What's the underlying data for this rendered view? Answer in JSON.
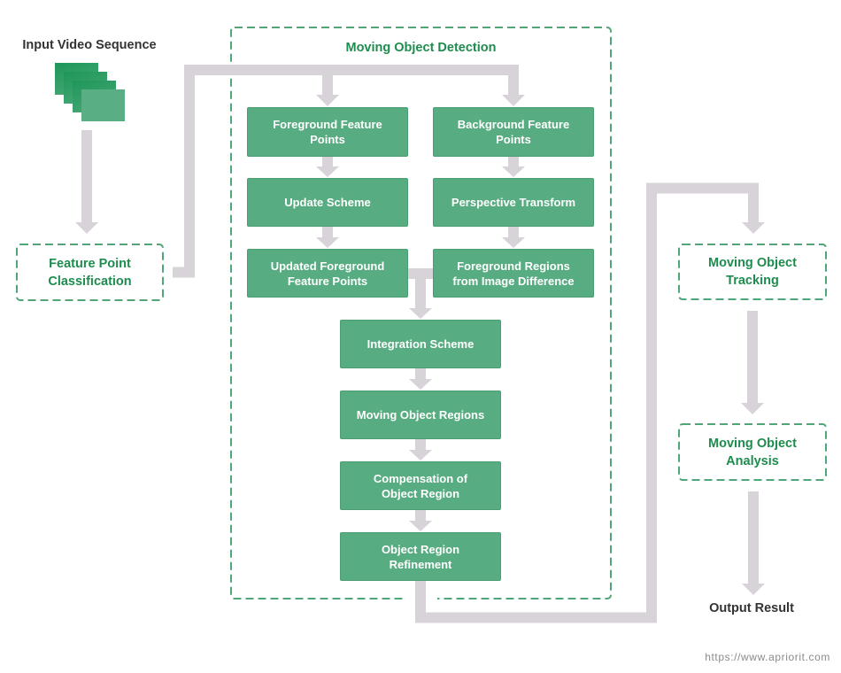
{
  "input": {
    "label": "Input Video Sequence",
    "frame_count": 4
  },
  "classification": {
    "lines": [
      "Feature Point",
      "Classification"
    ]
  },
  "detection": {
    "title": "Moving Object Detection",
    "left_column": [
      {
        "lines": [
          "Foreground Feature",
          "Points"
        ]
      },
      {
        "lines": [
          "Update Scheme"
        ]
      },
      {
        "lines": [
          "Updated Foreground",
          "Feature Points"
        ]
      }
    ],
    "right_column": [
      {
        "lines": [
          "Background Feature",
          "Points"
        ]
      },
      {
        "lines": [
          "Perspective Transform"
        ]
      },
      {
        "lines": [
          "Foreground Regions",
          "from Image Difference"
        ]
      }
    ],
    "center_column": [
      {
        "lines": [
          "Integration Scheme"
        ]
      },
      {
        "lines": [
          "Moving Object Regions"
        ]
      },
      {
        "lines": [
          "Compensation of",
          "Object Region"
        ]
      },
      {
        "lines": [
          "Object Region",
          "Refinement"
        ]
      }
    ]
  },
  "tracking": {
    "lines": [
      "Moving Object",
      "Tracking"
    ]
  },
  "analysis": {
    "lines": [
      "Moving Object",
      "Analysis"
    ]
  },
  "output": {
    "label": "Output Result"
  },
  "footer": {
    "url": "https://www.apriorit.com"
  },
  "colors": {
    "step_fill": "#58ac81",
    "accent_text": "#1e8c4e",
    "dashed_border": "#4fa676",
    "connector": "#d8d3d9",
    "label_text": "#333333"
  }
}
